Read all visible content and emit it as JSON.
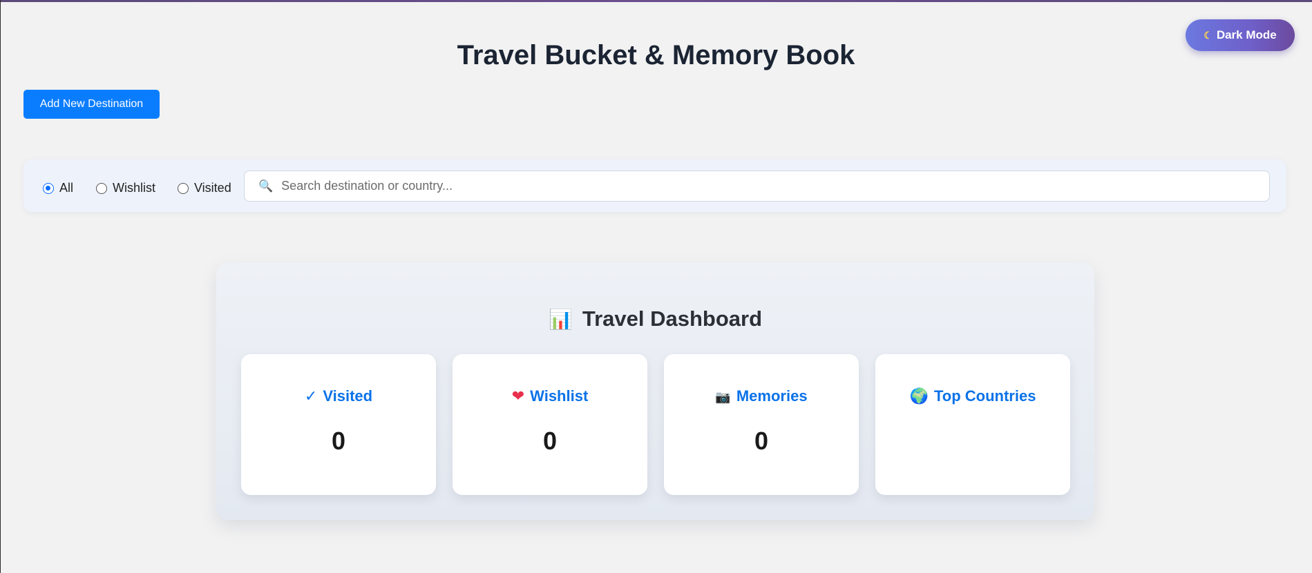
{
  "header": {
    "title": "Travel Bucket & Memory Book",
    "dark_mode_label": "Dark Mode",
    "dark_mode_icon": "moon-icon"
  },
  "toolbar": {
    "add_label": "Add New Destination"
  },
  "filters": {
    "options": [
      {
        "label": "All",
        "checked": true
      },
      {
        "label": "Wishlist",
        "checked": false
      },
      {
        "label": "Visited",
        "checked": false
      }
    ],
    "search": {
      "placeholder": "Search destination or country...",
      "value": "",
      "icon": "magnifier-icon"
    }
  },
  "dashboard": {
    "title": "Travel Dashboard",
    "title_icon": "bar-chart-icon",
    "cards": [
      {
        "label": "Visited",
        "icon": "checkmark-icon",
        "glyph": "✓",
        "value": "0"
      },
      {
        "label": "Wishlist",
        "icon": "heart-icon",
        "glyph": "❤",
        "value": "0"
      },
      {
        "label": "Memories",
        "icon": "camera-icon",
        "glyph": "📷",
        "value": "0"
      },
      {
        "label": "Top Countries",
        "icon": "globe-icon",
        "glyph": "🌍",
        "value": ""
      }
    ]
  },
  "colors": {
    "accent": "#0a7dff",
    "card_title": "#0a72e8",
    "background": "#f2f2f2"
  }
}
